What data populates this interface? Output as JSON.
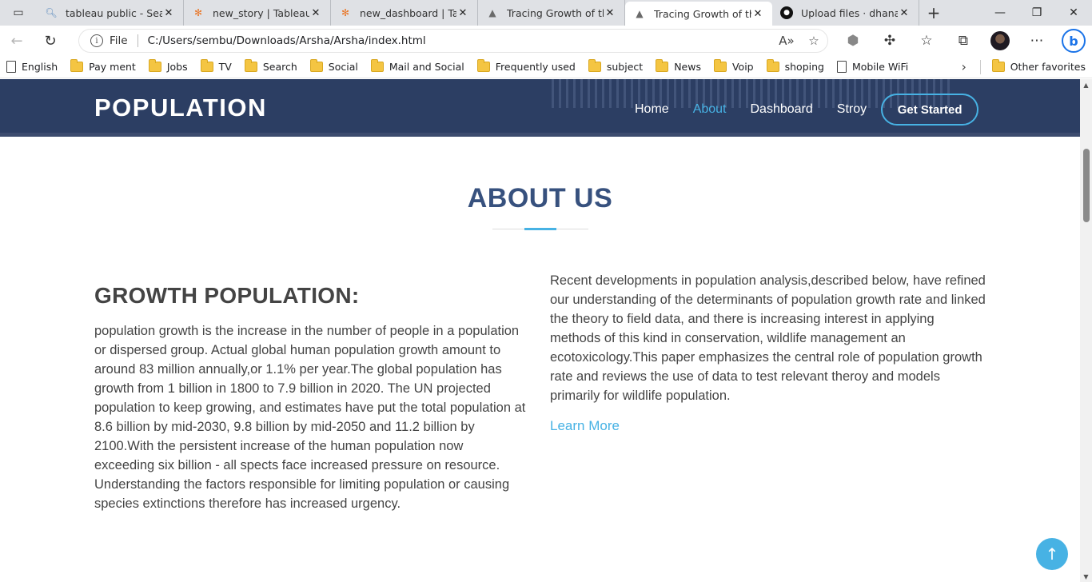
{
  "browser": {
    "tabs": [
      {
        "label": "tableau public - Search",
        "icon": "search-icon",
        "active": false
      },
      {
        "label": "new_story | Tableau Public",
        "icon": "tableau-icon",
        "active": false
      },
      {
        "label": "new_dashboard | Tableau Public",
        "icon": "tableau-icon",
        "active": false
      },
      {
        "label": "Tracing Growth of the Population",
        "icon": "site-icon",
        "active": false
      },
      {
        "label": "Tracing Growth of the Population",
        "icon": "site-icon",
        "active": true
      },
      {
        "label": "Upload files · dhanasekar",
        "icon": "github-icon",
        "active": false
      }
    ],
    "address": {
      "scheme": "File",
      "url": "C:/Users/sembu/Downloads/Arsha/Arsha/index.html"
    },
    "bookmarks": [
      {
        "label": "English",
        "type": "page"
      },
      {
        "label": "Pay ment",
        "type": "folder"
      },
      {
        "label": "Jobs",
        "type": "folder"
      },
      {
        "label": "TV",
        "type": "folder"
      },
      {
        "label": "Search",
        "type": "folder"
      },
      {
        "label": "Social",
        "type": "folder"
      },
      {
        "label": "Mail and Social",
        "type": "folder"
      },
      {
        "label": "Frequently used",
        "type": "folder"
      },
      {
        "label": "subject",
        "type": "folder"
      },
      {
        "label": "News",
        "type": "folder"
      },
      {
        "label": "Voip",
        "type": "folder"
      },
      {
        "label": "shoping",
        "type": "folder"
      },
      {
        "label": "Mobile WiFi",
        "type": "page"
      }
    ],
    "other_favorites": "Other favorites"
  },
  "site": {
    "logo": "POPULATION",
    "nav": [
      {
        "label": "Home",
        "active": false
      },
      {
        "label": "About",
        "active": true
      },
      {
        "label": "Dashboard",
        "active": false
      },
      {
        "label": "Stroy",
        "active": false
      }
    ],
    "cta": "Get Started",
    "colors": {
      "header": "#2c3e63",
      "accent": "#47b2e4",
      "title": "#37517e"
    }
  },
  "about": {
    "title": "ABOUT US",
    "left_heading": "GROWTH POPULATION:",
    "left_text": "population growth is the increase in the number of people in a population or dispersed group. Actual global human population growth amount to around 83 million annually,or 1.1% per year.The global population has growth from 1 billion in 1800 to 7.9 billion in 2020. The UN projected population to keep growing, and estimates have put the total population at 8.6 billion by mid-2030, 9.8 billion by mid-2050 and 11.2 billion by 2100.With the persistent increase of the human population now exceeding six billion - all spects face increased pressure on resource. Understanding the factors responsible for limiting population or causing species extinctions therefore has increased urgency.",
    "right_text": "Recent developments in population analysis,described below, have refined our understanding of the determinants of population growth rate and linked the theory to field data, and there is increasing interest in applying methods of this kind in conservation, wildlife management an ecotoxicology.This paper emphasizes the central role of population growth rate and reviews the use of data to test relevant theroy and models primarily for wildlife population.",
    "learn_more": "Learn More"
  }
}
